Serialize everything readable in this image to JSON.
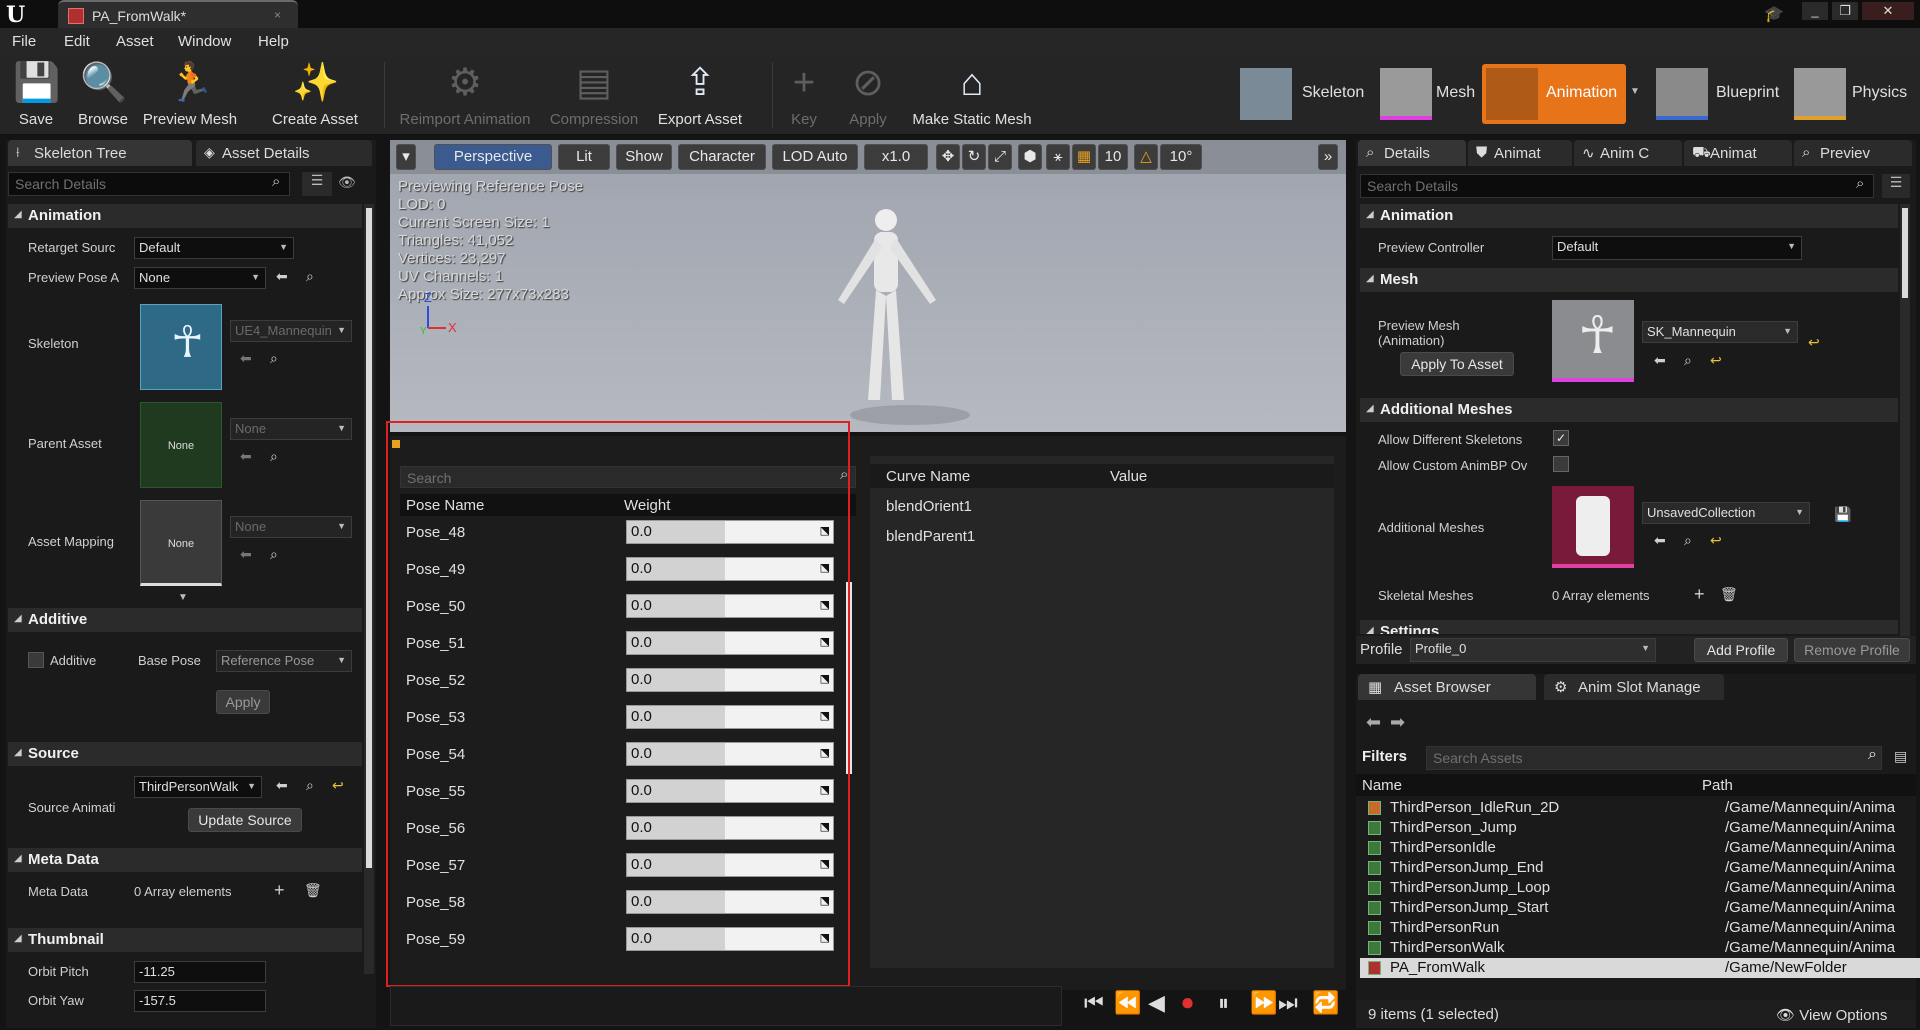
{
  "window": {
    "tab_title": "PA_FromWalk*",
    "controls": [
      "_",
      "❐",
      "✕"
    ]
  },
  "menu": [
    "File",
    "Edit",
    "Asset",
    "Window",
    "Help"
  ],
  "toolbar": {
    "buttons": [
      {
        "label": "Save",
        "icon": "save-icon"
      },
      {
        "label": "Browse",
        "icon": "browse-icon"
      },
      {
        "label": "Preview Mesh",
        "icon": "preview-mesh-icon"
      },
      {
        "label": "Create Asset",
        "icon": "create-asset-icon"
      },
      {
        "label": "Reimport Animation",
        "icon": "reimport-icon",
        "disabled": true
      },
      {
        "label": "Compression",
        "icon": "compression-icon",
        "disabled": true
      },
      {
        "label": "Export Asset",
        "icon": "export-icon"
      },
      {
        "label": "Key",
        "icon": "key-plus-icon",
        "disabled": true
      },
      {
        "label": "Apply",
        "icon": "apply-check-icon",
        "disabled": true
      },
      {
        "label": "Make Static Mesh",
        "icon": "static-mesh-icon"
      }
    ],
    "modes": [
      "Skeleton",
      "Mesh",
      "Animation",
      "Blueprint",
      "Physics"
    ]
  },
  "left_panel": {
    "tabs": [
      "Skeleton Tree",
      "Asset Details"
    ],
    "search_placeholder": "Search Details",
    "animation": {
      "title": "Animation",
      "retarget_label": "Retarget Sourc",
      "retarget_value": "Default",
      "preview_pose_label": "Preview Pose A",
      "preview_pose_value": "None",
      "skeleton_label": "Skeleton",
      "skeleton_value": "UE4_Mannequin",
      "parent_label": "Parent Asset",
      "parent_value": "None",
      "parent_thumb": "None",
      "mapping_label": "Asset Mapping",
      "mapping_value": "None",
      "mapping_thumb": "None"
    },
    "additive": {
      "title": "Additive",
      "checkbox": "Additive",
      "base_pose_label": "Base Pose",
      "base_pose_value": "Reference Pose",
      "apply": "Apply"
    },
    "source": {
      "title": "Source",
      "label": "Source Animati",
      "value": "ThirdPersonWalk",
      "update": "Update Source"
    },
    "meta": {
      "title": "Meta Data",
      "label": "Meta Data",
      "value": "0 Array elements"
    },
    "thumbnail": {
      "title": "Thumbnail",
      "pitch_label": "Orbit Pitch",
      "pitch": "-11.25",
      "yaw_label": "Orbit Yaw",
      "yaw": "-157.5"
    }
  },
  "viewport": {
    "buttons": [
      "Perspective",
      "Lit",
      "Show",
      "Character",
      "LOD Auto",
      "x1.0",
      "10",
      "10°"
    ],
    "hud": [
      "Previewing Reference Pose",
      "LOD: 0",
      "Current Screen Size: 1",
      "Triangles: 41,052",
      "Vertices: 23,297",
      "UV Channels: 1",
      "Approx Size: 277x73x283"
    ],
    "axes": {
      "z": "Z",
      "x": "X",
      "y": "Y"
    }
  },
  "pose_panel": {
    "search_placeholder": "Search",
    "col_name": "Pose Name",
    "col_weight": "Weight",
    "rows": [
      {
        "name": "Pose_48",
        "weight": "0.0"
      },
      {
        "name": "Pose_49",
        "weight": "0.0"
      },
      {
        "name": "Pose_50",
        "weight": "0.0"
      },
      {
        "name": "Pose_51",
        "weight": "0.0"
      },
      {
        "name": "Pose_52",
        "weight": "0.0"
      },
      {
        "name": "Pose_53",
        "weight": "0.0"
      },
      {
        "name": "Pose_54",
        "weight": "0.0"
      },
      {
        "name": "Pose_55",
        "weight": "0.0"
      },
      {
        "name": "Pose_56",
        "weight": "0.0"
      },
      {
        "name": "Pose_57",
        "weight": "0.0"
      },
      {
        "name": "Pose_58",
        "weight": "0.0"
      },
      {
        "name": "Pose_59",
        "weight": "0.0"
      }
    ],
    "highlight_color": "#e02020"
  },
  "curve_panel": {
    "col_name": "Curve Name",
    "col_value": "Value",
    "rows": [
      "blendOrient1",
      "blendParent1"
    ]
  },
  "right_panel": {
    "tabs": [
      "Details",
      "Animat",
      "Anim C",
      "Animat",
      "Previev"
    ],
    "search_placeholder": "Search Details",
    "animation": {
      "title": "Animation",
      "controller_label": "Preview Controller",
      "controller_value": "Default"
    },
    "mesh": {
      "title": "Mesh",
      "preview_label": "Preview Mesh\n(Animation)",
      "preview_value": "SK_Mannequin",
      "apply": "Apply To Asset"
    },
    "additional": {
      "title": "Additional Meshes",
      "allow_diff": "Allow Different Skeletons",
      "allow_custom": "Allow Custom AnimBP Ov",
      "meshes_label": "Additional Meshes",
      "meshes_value": "UnsavedCollection",
      "skeletal_label": "Skeletal Meshes",
      "skeletal_value": "0 Array elements"
    },
    "settings": {
      "title": "Settings"
    },
    "profile": {
      "label": "Profile",
      "value": "Profile_0",
      "add": "Add Profile",
      "remove": "Remove Profile"
    }
  },
  "asset_browser": {
    "tabs": [
      "Asset Browser",
      "Anim Slot Manage"
    ],
    "filters": "Filters",
    "search_placeholder": "Search Assets",
    "col_name": "Name",
    "col_path": "Path",
    "rows": [
      {
        "name": "ThirdPerson_IdleRun_2D",
        "path": "/Game/Mannequin/Anima",
        "type": "blendspace"
      },
      {
        "name": "ThirdPerson_Jump",
        "path": "/Game/Mannequin/Anima",
        "type": "anim"
      },
      {
        "name": "ThirdPersonIdle",
        "path": "/Game/Mannequin/Anima",
        "type": "anim"
      },
      {
        "name": "ThirdPersonJump_End",
        "path": "/Game/Mannequin/Anima",
        "type": "anim"
      },
      {
        "name": "ThirdPersonJump_Loop",
        "path": "/Game/Mannequin/Anima",
        "type": "anim"
      },
      {
        "name": "ThirdPersonJump_Start",
        "path": "/Game/Mannequin/Anima",
        "type": "anim"
      },
      {
        "name": "ThirdPersonRun",
        "path": "/Game/Mannequin/Anima",
        "type": "anim"
      },
      {
        "name": "ThirdPersonWalk",
        "path": "/Game/Mannequin/Anima",
        "type": "anim"
      },
      {
        "name": "PA_FromWalk",
        "path": "/Game/NewFolder",
        "type": "pose",
        "selected": true
      }
    ],
    "status": "9 items (1 selected)",
    "view_options": "View Options"
  },
  "colors": {
    "accent_orange": "#e8741a",
    "selection": "#d9d9d9",
    "highlight": "#e02020"
  }
}
